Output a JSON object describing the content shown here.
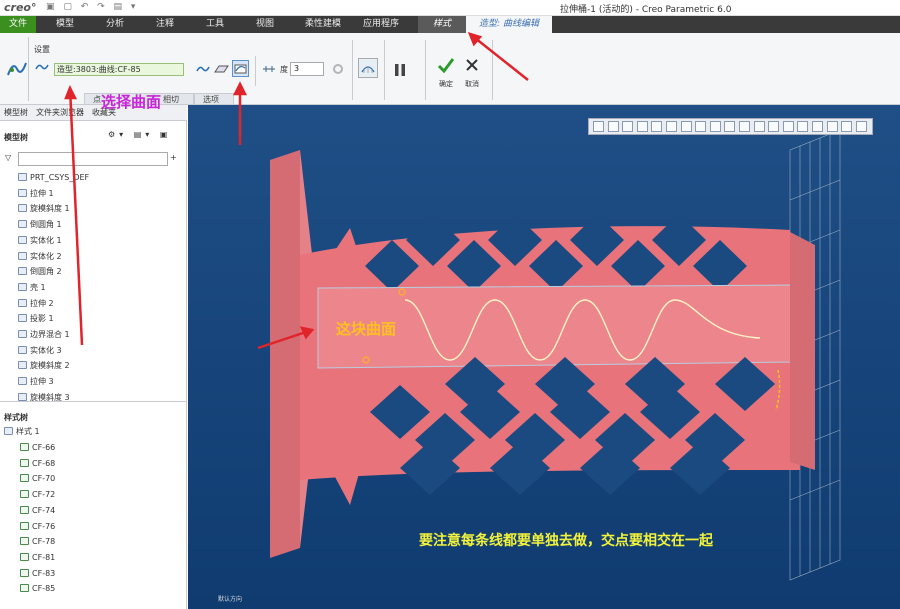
{
  "titlebar": {
    "logo": "creo°",
    "window_title": "拉伸桶-1 (活动的) - Creo Parametric 6.0"
  },
  "menu": {
    "file": "文件",
    "tabs": [
      "模型",
      "分析",
      "注释",
      "工具",
      "视图",
      "柔性建模",
      "应用程序"
    ],
    "style": "样式",
    "active": "造型: 曲线编辑"
  },
  "ribbon": {
    "settings_label": "设置",
    "curve_field": "造型:3803:曲线:CF-85",
    "spin_value": "3",
    "spin_label": "度",
    "ok_label": "确定",
    "cancel_label": "取消",
    "subtabs": [
      "点",
      "相切",
      "选项"
    ]
  },
  "left_panel": {
    "tabs": [
      "模型树",
      "文件夹浏览器",
      "收藏夹"
    ],
    "model_tree_title": "模型树",
    "model_tree_items": [
      "PRT_CSYS_DEF",
      "拉伸 1",
      "旋模斜度 1",
      "倒圆角 1",
      "实体化 1",
      "实体化 2",
      "倒圆角 2",
      "壳 1",
      "拉伸 2",
      "投影 1",
      "边界混合 1",
      "实体化 3",
      "旋模斜度 2",
      "拉伸 3",
      "旋模斜度 3"
    ],
    "style_tree_title": "样式树",
    "style_root": "样式 1",
    "style_items": [
      "CF-66",
      "CF-68",
      "CF-70",
      "CF-72",
      "CF-74",
      "CF-76",
      "CF-78",
      "CF-81",
      "CF-83",
      "CF-85"
    ]
  },
  "annotations": {
    "select_surface": "选择曲面",
    "this_surface": "这块曲面",
    "note": "要注意每条线都要单独去做，交点要相交在一起"
  },
  "viewport": {
    "status": "默认方向"
  },
  "colors": {
    "model": "#e8737a",
    "viewport_bg": "#1a4a80",
    "arrow": "#e0242a"
  }
}
